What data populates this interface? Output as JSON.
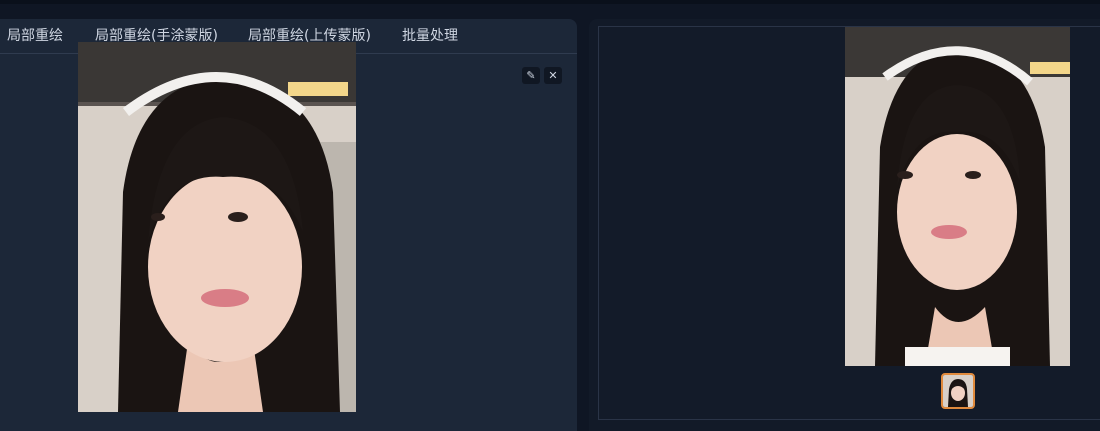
{
  "tabs": [
    {
      "label": "局部重绘"
    },
    {
      "label": "局部重绘(手涂蒙版)"
    },
    {
      "label": "局部重绘(上传蒙版)"
    },
    {
      "label": "批量处理"
    }
  ],
  "editor": {
    "image_icon": "portrait-photo",
    "edit_icon": "pencil-icon",
    "close_icon": "close-icon",
    "edit_glyph": "✎",
    "close_glyph": "✕"
  },
  "result": {
    "image_icon": "portrait-photo",
    "thumbnail_icon": "portrait-thumbnail"
  },
  "colors": {
    "accent": "#e08a3c",
    "panel": "#1c2738",
    "background": "#0f1624"
  }
}
